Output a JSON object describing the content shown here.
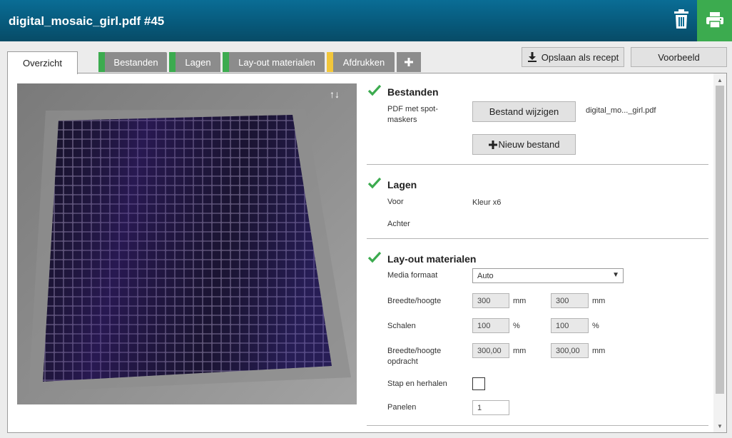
{
  "header": {
    "title": "digital_mosaic_girl.pdf #45"
  },
  "tabs": [
    {
      "label": "Overzicht",
      "active": true
    },
    {
      "label": "Bestanden",
      "stripe": "#3cab4f"
    },
    {
      "label": "Lagen",
      "stripe": "#3cab4f"
    },
    {
      "label": "Lay-out materialen",
      "stripe": "#3cab4f"
    },
    {
      "label": "Afdrukken",
      "stripe": "#f2c63a"
    }
  ],
  "plus_label": "+",
  "toolbar": {
    "save_recipe": "Opslaan als recept",
    "preview": "Voorbeeld"
  },
  "preview_controls": {
    "arrows": "↑↓"
  },
  "sections": {
    "bestanden": {
      "title": "Bestanden",
      "pdf_label": "PDF met spot-maskers",
      "change_file": "Bestand wijzigen",
      "filename": "digital_mo..._girl.pdf",
      "new_file": "Nieuw bestand"
    },
    "lagen": {
      "title": "Lagen",
      "front_label": "Voor",
      "front_value": "Kleur x6",
      "back_label": "Achter"
    },
    "layout": {
      "title": "Lay-out materialen",
      "media_label": "Media formaat",
      "media_value": "Auto",
      "wh_label": "Breedte/hoogte",
      "width": "300",
      "height": "300",
      "unit_mm": "mm",
      "scale_label": "Schalen",
      "scale_x": "100",
      "scale_y": "100",
      "unit_pct": "%",
      "wh_job_label": "Breedte/hoogte opdracht",
      "job_width": "300,00",
      "job_height": "300,00",
      "step_label": "Stap en herhalen",
      "panels_label": "Panelen",
      "panels_value": "1"
    }
  },
  "colors": {
    "accent_green": "#3cab4f",
    "header_blue": "#075a7c",
    "stripe_yellow": "#f2c63a"
  }
}
